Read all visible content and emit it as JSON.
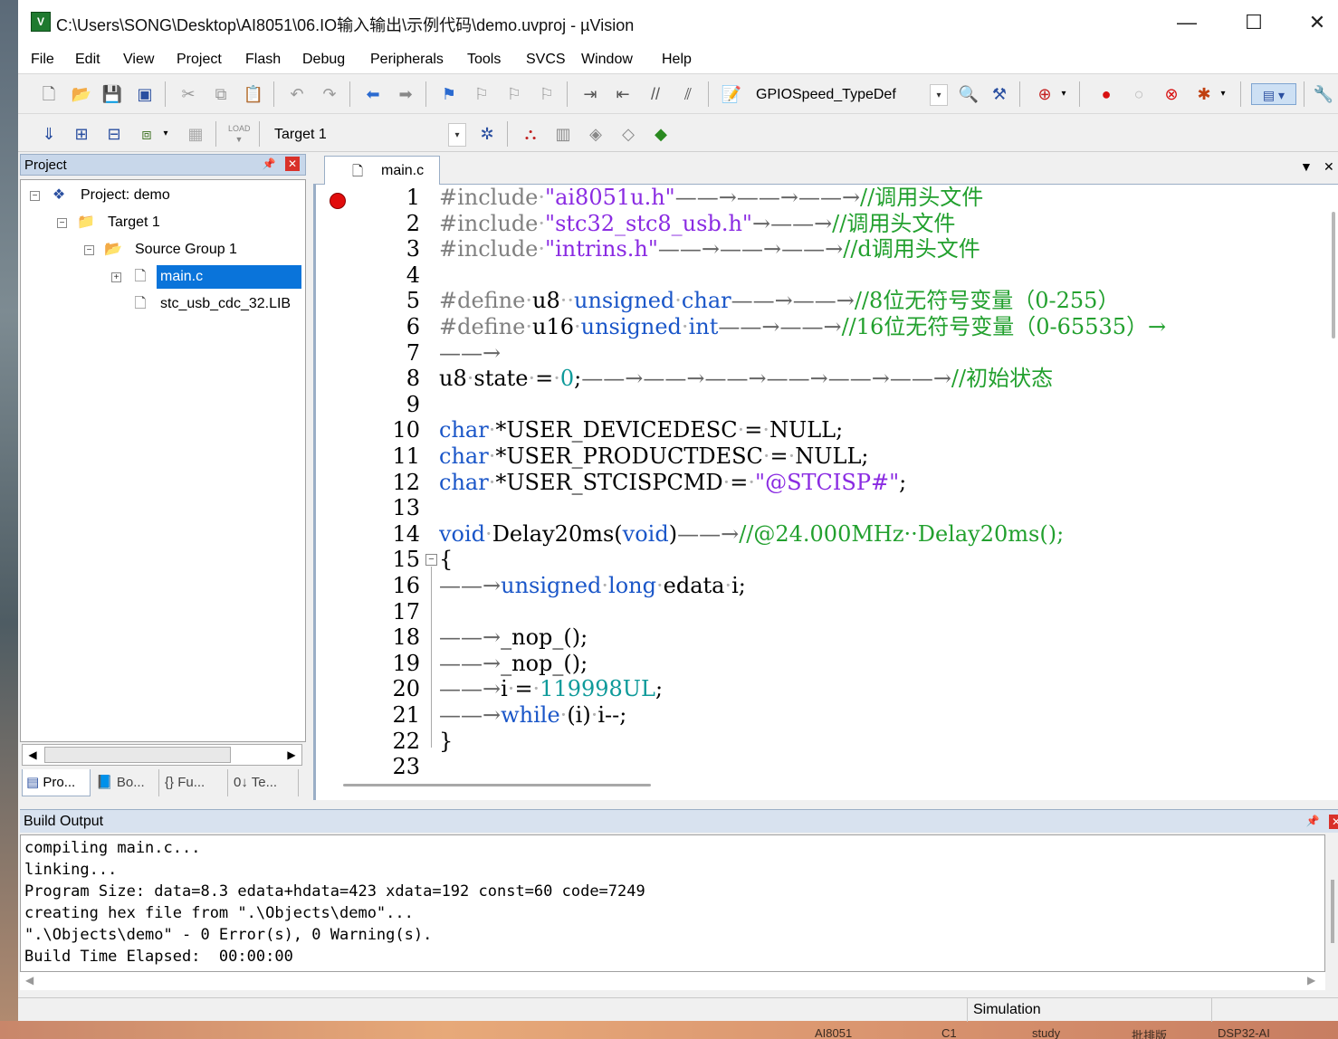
{
  "window": {
    "title": "C:\\Users\\SONG\\Desktop\\AI8051\\06.IO输入输出\\示例代码\\demo.uvproj - µVision",
    "minimize": "—",
    "maximize": "☐",
    "close": "✕"
  },
  "menu": [
    "File",
    "Edit",
    "View",
    "Project",
    "Flash",
    "Debug",
    "Peripherals",
    "Tools",
    "SVCS",
    "Window",
    "Help"
  ],
  "toolbar": {
    "symbol_combo": "GPIOSpeed_TypeDef",
    "target_combo": "Target 1",
    "load_label": "LOAD"
  },
  "project_panel": {
    "title": "Project",
    "tree": {
      "project": "Project: demo",
      "target": "Target 1",
      "group": "Source Group 1",
      "file_main": "main.c",
      "file_lib": "stc_usb_cdc_32.LIB"
    },
    "tabs": [
      "Pro...",
      "Bo...",
      "Fu...",
      "Te..."
    ]
  },
  "editor": {
    "tab": "main.c",
    "line_numbers": [
      "1",
      "2",
      "3",
      "4",
      "5",
      "6",
      "7",
      "8",
      "9",
      "10",
      "11",
      "12",
      "13",
      "14",
      "15",
      "16",
      "17",
      "18",
      "19",
      "20",
      "21",
      "22",
      "23"
    ],
    "breakpoint_line": 1,
    "fold_line": 15
  },
  "build_output": {
    "title": "Build Output",
    "lines": [
      "compiling main.c...",
      "linking...",
      "Program Size: data=8.3 edata+hdata=423 xdata=192 const=60 code=7249",
      "creating hex file from \".\\Objects\\demo\"...",
      "\".\\Objects\\demo\" - 0 Error(s), 0 Warning(s).",
      "Build Time Elapsed:  00:00:00"
    ]
  },
  "statusbar": {
    "mode": "Simulation"
  },
  "desktop_taskbar": [
    "AI8051",
    "C1",
    "study",
    "批排版",
    "DSP32-AI"
  ],
  "colors": {
    "keyword": "#1a56c8",
    "comment": "#22a02e",
    "string": "#8a2be2",
    "number": "#0e9a9a",
    "preprocessor": "#808080",
    "selection": "#0a74da",
    "breakpoint": "#e10c0c"
  }
}
